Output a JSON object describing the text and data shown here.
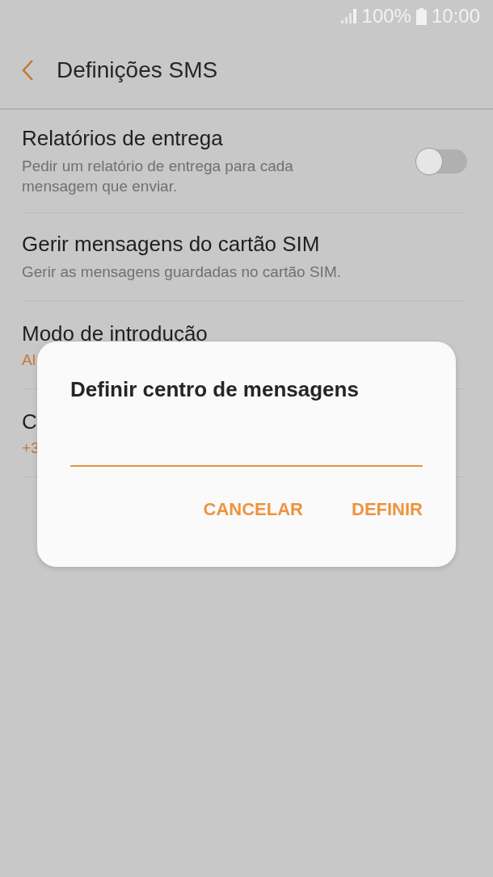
{
  "status_bar": {
    "battery": "100%",
    "time": "10:00"
  },
  "header": {
    "title": "Definições SMS"
  },
  "settings": [
    {
      "kind": "toggle",
      "title": "Relatórios de entrega",
      "subtitle": "Pedir um relatório de entrega para cada mensagem que enviar.",
      "on": false
    },
    {
      "kind": "plain",
      "title": "Gerir mensagens do cartão SIM",
      "subtitle": "Gerir as mensagens guardadas no cartão SIM."
    },
    {
      "kind": "value",
      "title": "Modo de introdução",
      "value": "Al"
    },
    {
      "kind": "value",
      "title": "C",
      "value": "+3"
    }
  ],
  "dialog": {
    "title": "Definir centro de mensagens",
    "buttons": [
      "CANCELAR",
      "DEFINIR"
    ]
  }
}
